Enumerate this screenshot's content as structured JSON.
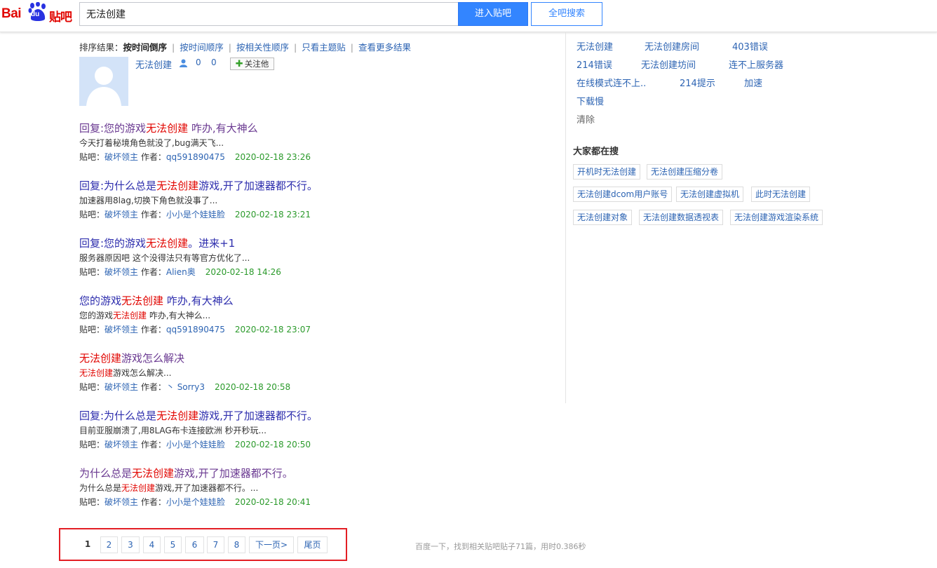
{
  "logo": {
    "bai": "Bai",
    "du": "du",
    "tieba": "贴吧"
  },
  "search": {
    "value": "无法创建",
    "enter_label": "进入贴吧",
    "all_label": "全吧搜索"
  },
  "sort_bar": {
    "label": "排序结果：",
    "current": "按时间倒序",
    "options": [
      "按时间顺序",
      "按相关性顺序",
      "只看主题贴",
      "查看更多结果"
    ]
  },
  "user": {
    "name": "无法创建",
    "follow_count": "0",
    "fans_count": "0",
    "follow_label": "关注他"
  },
  "results": [
    {
      "title": [
        "回复:您的游戏",
        "无法创建",
        " 咋办,有大神么"
      ],
      "snippet": [
        "今天打着秘境角色就没了,bug满天飞...",
        "",
        ""
      ],
      "bar": "破坏领主",
      "author": "qq591890475",
      "time": "2020-02-18 23:26",
      "visited": true
    },
    {
      "title": [
        "回复:为什么总是",
        "无法创建",
        "游戏,开了加速器都不行。"
      ],
      "snippet": [
        "加速器用8lag,切换下角色就没事了...",
        "",
        ""
      ],
      "bar": "破坏领主",
      "author": "小小是个娃娃脸",
      "time": "2020-02-18 23:21",
      "visited": false
    },
    {
      "title": [
        "回复:您的游戏",
        "无法创建",
        "。进来+1"
      ],
      "snippet": [
        "服务器原因吧 这个没得法只有等官方优化了...",
        "",
        ""
      ],
      "bar": "破坏领主",
      "author": "Alien奥",
      "time": "2020-02-18 14:26",
      "visited": false
    },
    {
      "title": [
        "您的游戏",
        "无法创建",
        " 咋办,有大神么"
      ],
      "snippet": [
        "您的游戏",
        "无法创建",
        " 咋办,有大神么..."
      ],
      "bar": "破坏领主",
      "author": "qq591890475",
      "time": "2020-02-18 23:07",
      "visited": false
    },
    {
      "title": [
        "",
        "无法创建",
        "游戏怎么解决"
      ],
      "snippet": [
        "",
        "无法创建",
        "游戏怎么解决..."
      ],
      "bar": "破坏领主",
      "author": "丶 Sorry3",
      "time": "2020-02-18 20:58",
      "visited": true
    },
    {
      "title": [
        "回复:为什么总是",
        "无法创建",
        "游戏,开了加速器都不行。"
      ],
      "snippet": [
        "目前亚服崩溃了,用8LAG布卡连接欧洲 秒开秒玩...",
        "",
        ""
      ],
      "bar": "破坏领主",
      "author": "小小是个娃娃脸",
      "time": "2020-02-18 20:50",
      "visited": false
    },
    {
      "title": [
        "为什么总是",
        "无法创建",
        "游戏,开了加速器都不行。"
      ],
      "snippet": [
        "为什么总是",
        "无法创建",
        "游戏,开了加速器都不行。..."
      ],
      "bar": "破坏领主",
      "author": "小小是个娃娃脸",
      "time": "2020-02-18 20:41",
      "visited": true
    }
  ],
  "meta_labels": {
    "bar_prefix": "贴吧：",
    "author_prefix": "作者："
  },
  "related": [
    [
      "无法创建",
      "无法创建房间",
      "403错误"
    ],
    [
      "214错误",
      "无法创建坊间",
      "连不上服务器"
    ],
    [
      "在线模式连不上..",
      "214提示",
      "加速"
    ],
    [
      "下载慢"
    ]
  ],
  "clear_label": "清除",
  "hot": {
    "title": "大家都在搜",
    "tags": [
      [
        "开机时无法创建",
        "无法创建压缩分卷"
      ],
      [
        "无法创建dcom用户账号",
        "无法创建虚拟机",
        "此时无法创建"
      ],
      [
        "无法创建对象",
        "无法创建数据透视表",
        "无法创建游戏渲染系统"
      ]
    ]
  },
  "pager": {
    "pages": [
      "1",
      "2",
      "3",
      "4",
      "5",
      "6",
      "7",
      "8"
    ],
    "next": "下一页>",
    "last": "尾页",
    "stats": "百度一下，找到相关贴吧贴子71篇，用时0.386秒"
  },
  "colors": {
    "accent": "#3385ff",
    "highlight": "#e10602",
    "link": "#2d2dad",
    "time": "#2b9a2b",
    "pager_frame": "#e31e24"
  }
}
